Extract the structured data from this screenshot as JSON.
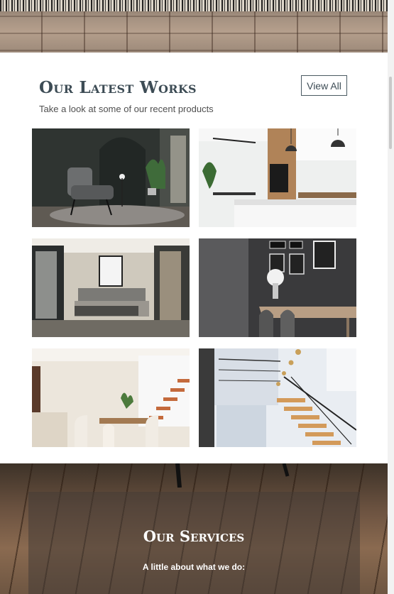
{
  "works": {
    "title": "Our Latest Works",
    "subtitle": "Take a look at some of our recent products",
    "view_all_label": "View All",
    "gallery": [
      {
        "name": "dark-lounge-armchair-photo"
      },
      {
        "name": "white-kitchen-pendant-photo"
      },
      {
        "name": "bedroom-interior-photo"
      },
      {
        "name": "gallery-wall-dining-photo"
      },
      {
        "name": "bright-dining-staircase-photo"
      },
      {
        "name": "wood-glass-staircase-photo"
      }
    ]
  },
  "services": {
    "title": "Our Services",
    "subtitle": "A little about what we do:"
  }
}
